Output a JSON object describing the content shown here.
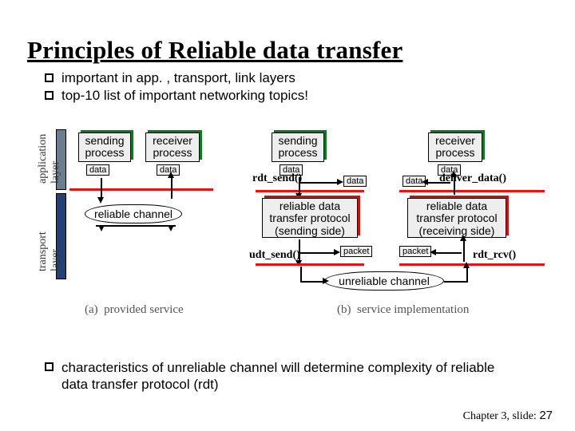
{
  "title": "Principles of Reliable data transfer",
  "bullets": {
    "b1": "important in app. , transport, link layers",
    "b2": "top-10 list of important networking topics!",
    "b3": "characteristics of unreliable channel will determine complexity of reliable data transfer protocol (rdt)"
  },
  "diagram": {
    "layer_app": "application\nlayer",
    "layer_trn": "transport\nlayer",
    "sending_proc": "sending\nprocess",
    "receiver_proc": "receiver\nprocess",
    "data": "data",
    "packet": "packet",
    "reliable_channel": "reliable channel",
    "unreliable_channel": "unreliable channel",
    "rdt_send": "rdt_send()",
    "udt_send": "udt_send()",
    "deliver_data": "deliver_data()",
    "rdt_rcv": "rdt_rcv()",
    "proto_send": "reliable data\ntransfer protocol\n(sending side)",
    "proto_recv": "reliable data\ntransfer protocol\n(receiving side)",
    "caption_a": "(a)",
    "caption_a_txt": "provided service",
    "caption_b": "(b)",
    "caption_b_txt": "service implementation"
  },
  "footer": {
    "chapter": "Chapter 3, slide:",
    "page": "27"
  }
}
